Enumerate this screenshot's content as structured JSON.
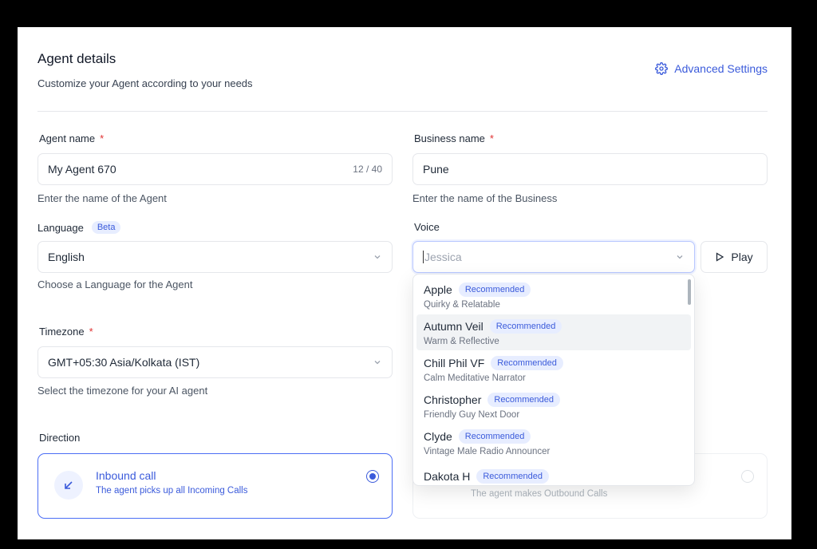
{
  "header": {
    "title": "Agent details",
    "subtitle": "Customize your Agent according to your needs",
    "advanced_settings": "Advanced Settings"
  },
  "agent_name": {
    "label": "Agent name",
    "required": "*",
    "value": "My Agent 670",
    "counter": "12 / 40",
    "help": "Enter the name of the Agent"
  },
  "business_name": {
    "label": "Business name",
    "required": "*",
    "value": "Pune",
    "help": "Enter the name of the Business"
  },
  "language": {
    "label": "Language",
    "badge": "Beta",
    "value": "English",
    "help": "Choose a Language for the Agent"
  },
  "voice": {
    "label": "Voice",
    "placeholder": "Jessica",
    "play_label": "Play"
  },
  "timezone": {
    "label": "Timezone",
    "required": "*",
    "value": "GMT+05:30 Asia/Kolkata (IST)",
    "help": "Select the timezone for your AI agent"
  },
  "direction": {
    "label": "Direction",
    "inbound_title": "Inbound call",
    "inbound_desc": "The agent picks up all Incoming Calls",
    "outbound_desc": "The agent makes Outbound Calls"
  },
  "voice_options": [
    {
      "name": "Apple",
      "badge": "Recommended",
      "desc": "Quirky & Relatable"
    },
    {
      "name": "Autumn Veil",
      "badge": "Recommended",
      "desc": "Warm & Reflective"
    },
    {
      "name": "Chill Phil VF",
      "badge": "Recommended",
      "desc": "Calm Meditative Narrator"
    },
    {
      "name": "Christopher",
      "badge": "Recommended",
      "desc": "Friendly Guy Next Door"
    },
    {
      "name": "Clyde",
      "badge": "Recommended",
      "desc": "Vintage Male Radio Announcer"
    },
    {
      "name": "Dakota H",
      "badge": "Recommended",
      "desc": ""
    }
  ],
  "colors": {
    "accent": "#3b5bdb",
    "badge_bg": "#e7edff",
    "required": "#e03131"
  }
}
